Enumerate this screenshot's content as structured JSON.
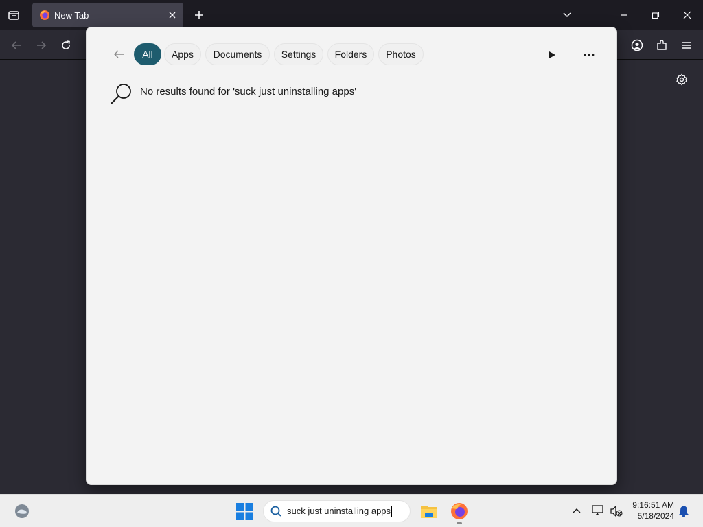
{
  "browser": {
    "tab_title": "New Tab"
  },
  "search_panel": {
    "filters": [
      "All",
      "Apps",
      "Documents",
      "Settings",
      "Folders",
      "Photos"
    ],
    "active_filter": "All",
    "message": "No results found for 'suck just uninstalling apps'"
  },
  "taskbar": {
    "search_query": "suck just uninstalling apps",
    "time": "9:16:51 AM",
    "date": "5/18/2024"
  },
  "colors": {
    "accent": "#1e5c6e",
    "browser_bg": "#2b2a33",
    "panel_bg": "#f3f3f3"
  }
}
